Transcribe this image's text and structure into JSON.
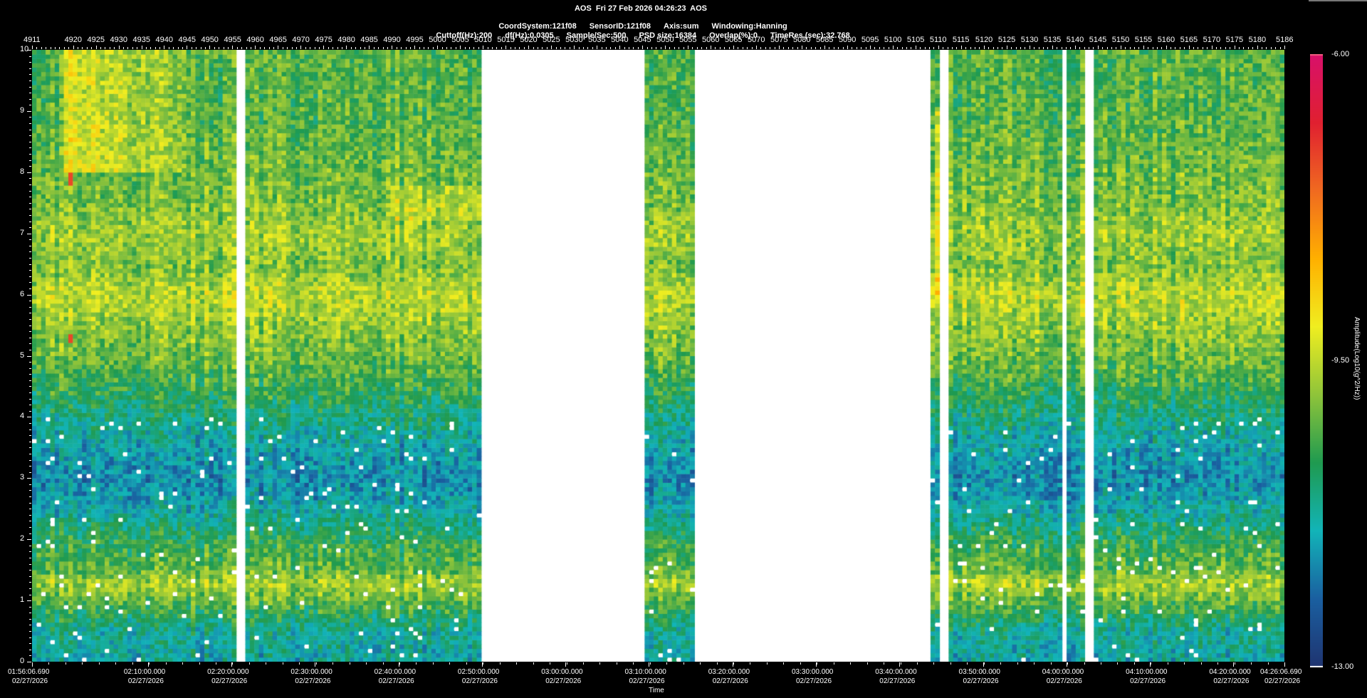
{
  "header": {
    "line1": "AOS  Fri 27 Feb 2026 04:26:23  AOS",
    "line2": [
      "CoordSystem:121f08",
      "SensorID:121f08",
      "Axis:sum",
      "Windowing:Hanning"
    ],
    "line3": [
      "Cuttoff(Hz):200",
      "df(Hz):0.0305",
      "Sample/Sec:500",
      "PSD size:16384",
      "Overlap(%):0",
      "TimeRes.(sec):32.768"
    ]
  },
  "chart_data": {
    "type": "heatmap",
    "title": "AOS  Fri 27 Feb 2026 04:26:23  AOS",
    "xlabel": "Time",
    "ylabel": "",
    "colorbar_label": "Amplitude(Log10(g^2/Hz))",
    "colorbar_range": [
      -13.0,
      -6.0
    ],
    "colorbar_ticks": [
      "-6.00",
      "-9.50",
      "-13.00"
    ],
    "colormap": [
      "#1f3470",
      "#1a5fa0",
      "#12b4b8",
      "#1f9a50",
      "#8fc43a",
      "#f0ee20",
      "#ffb000",
      "#f06a20",
      "#e02030",
      "#d8106a"
    ],
    "ylim": [
      0,
      10
    ],
    "yticks": [
      "0",
      "1",
      "2",
      "3",
      "4",
      "5",
      "6",
      "7",
      "8",
      "9",
      "10"
    ],
    "record_range": [
      4911,
      5186
    ],
    "top_ticks": [
      "4911",
      "4920",
      "4925",
      "4930",
      "4935",
      "4940",
      "4945",
      "4950",
      "4955",
      "4960",
      "4965",
      "4970",
      "4975",
      "4980",
      "4985",
      "4990",
      "4995",
      "5000",
      "5005",
      "5010",
      "5015",
      "5020",
      "5025",
      "5030",
      "5035",
      "5040",
      "5045",
      "5050",
      "5055",
      "5060",
      "5065",
      "5070",
      "5075",
      "5080",
      "5085",
      "5090",
      "5095",
      "5100",
      "5105",
      "5110",
      "5115",
      "5120",
      "5125",
      "5130",
      "5135",
      "5140",
      "5145",
      "5150",
      "5155",
      "5160",
      "5165",
      "5170",
      "5175",
      "5180",
      "5186"
    ],
    "time_ticks": [
      {
        "time": "01:56:06.690",
        "date": "02/27/2026"
      },
      {
        "time": "02:10:00.000",
        "date": "02/27/2026"
      },
      {
        "time": "02:20:00.000",
        "date": "02/27/2026"
      },
      {
        "time": "02:30:00.000",
        "date": "02/27/2026"
      },
      {
        "time": "02:40:00.000",
        "date": "02/27/2026"
      },
      {
        "time": "02:50:00.000",
        "date": "02/27/2026"
      },
      {
        "time": "03:00:00.000",
        "date": "02/27/2026"
      },
      {
        "time": "03:10:00.000",
        "date": "02/27/2026"
      },
      {
        "time": "03:20:00.000",
        "date": "02/27/2026"
      },
      {
        "time": "03:30:00.000",
        "date": "02/27/2026"
      },
      {
        "time": "03:40:00.000",
        "date": "02/27/2026"
      },
      {
        "time": "03:50:00.000",
        "date": "02/27/2026"
      },
      {
        "time": "04:00:00.000",
        "date": "02/27/2026"
      },
      {
        "time": "04:10:00.000",
        "date": "02/27/2026"
      },
      {
        "time": "04:20:00.000",
        "date": "02/27/2026"
      },
      {
        "time": "04:26:06.690",
        "date": "02/27/2026"
      }
    ],
    "missing_records": [
      [
        4956,
        4957
      ],
      [
        5010,
        5045
      ],
      [
        5057,
        5108
      ],
      [
        5111,
        5112
      ],
      [
        5138,
        5138
      ],
      [
        5143,
        5144
      ]
    ],
    "mean_profile": {
      "freq_hz": [
        0,
        0.5,
        1.0,
        1.3,
        1.5,
        2.0,
        2.5,
        3.0,
        3.5,
        4.0,
        4.5,
        5.0,
        5.5,
        6.0,
        6.5,
        7.0,
        7.5,
        8.0,
        8.5,
        9.0,
        9.5,
        10.0
      ],
      "amplitude": [
        -11.4,
        -11.2,
        -10.2,
        -9.6,
        -10.2,
        -10.6,
        -11.4,
        -11.8,
        -11.5,
        -11.0,
        -10.5,
        -10.1,
        -9.8,
        -9.5,
        -10.0,
        -9.7,
        -10.0,
        -10.1,
        -10.2,
        -10.3,
        -10.3,
        -10.3
      ]
    }
  }
}
